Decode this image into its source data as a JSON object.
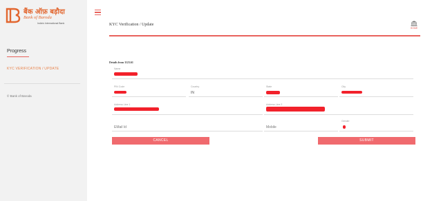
{
  "brand": {
    "name_hindi": "बैंक ऑफ़ बड़ौदा",
    "name_english": "Bank of Baroda",
    "tagline": "India's International Bank",
    "color": "#e2662f"
  },
  "sidebar": {
    "progress_title": "Progress",
    "step_label": "KYC VERIFICATION / UPDATE",
    "copyright": "© Bank of Baroda"
  },
  "header": {
    "menu_icon": "hamburger-icon",
    "title": "KYC Verification / Update",
    "home_label": "HOME",
    "home_icon": "bank-building-icon"
  },
  "form": {
    "details_label": "Details from 1123.61",
    "fields": {
      "name": {
        "label": "Name",
        "value": ""
      },
      "pin_code": {
        "label": "PIN Code",
        "value": ""
      },
      "country": {
        "label": "Country",
        "value": "IN"
      },
      "state": {
        "label": "State",
        "value": ""
      },
      "city": {
        "label": "City",
        "value": ""
      },
      "address_line_1": {
        "label": "Address Line 1",
        "value": ""
      },
      "address_line_2": {
        "label": "Address Line 2",
        "value": ""
      },
      "email": {
        "label": "",
        "value": "EMail Id"
      },
      "mobile": {
        "label": "",
        "value": "Mobile"
      },
      "gender": {
        "label": "Gender",
        "value": ""
      }
    },
    "cancel_label": "CANCEL",
    "submit_label": "SUBMIT"
  },
  "colors": {
    "accent": "#e8615b",
    "button": "#f06a6e",
    "redaction": "#f2212b",
    "sidebar_bg": "#f2f2f2"
  }
}
